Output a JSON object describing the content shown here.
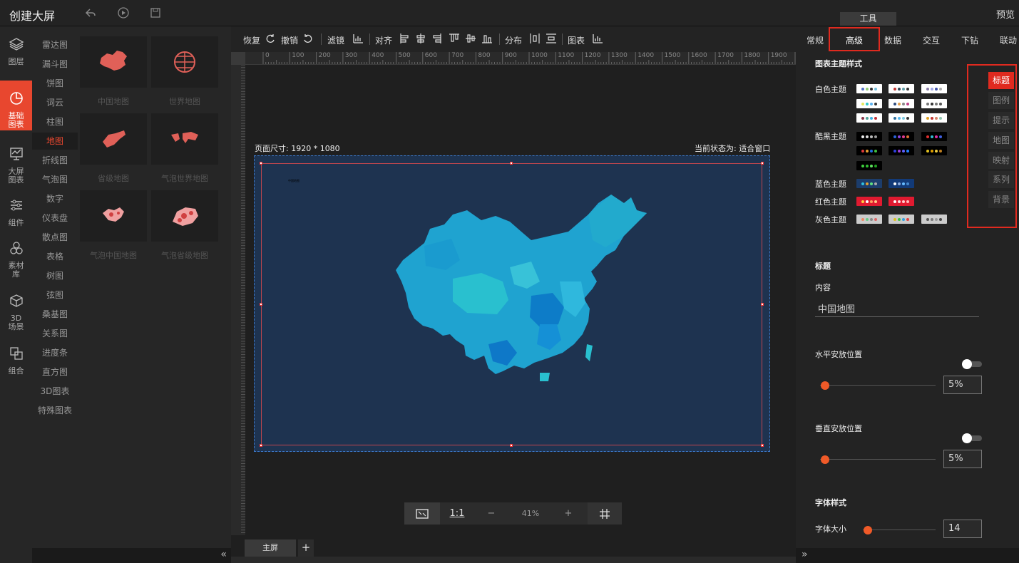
{
  "app": {
    "title": "创建大屏",
    "preview": "预览",
    "tool_tab": "工具"
  },
  "leftnav": [
    {
      "label": "图层",
      "icon": "layers-icon"
    },
    {
      "label": "基础图表",
      "icon": "pie-chart-icon",
      "active": true
    },
    {
      "label": "大屏图表",
      "icon": "dashboard-icon"
    },
    {
      "label": "组件",
      "icon": "sliders-icon"
    },
    {
      "label": "素材库",
      "icon": "hexagon-icon"
    },
    {
      "label": "3D场景",
      "icon": "cube-icon"
    },
    {
      "label": "组合",
      "icon": "combine-icon"
    }
  ],
  "categories": [
    "雷达图",
    "漏斗图",
    "饼图",
    "词云",
    "柱图",
    "地图",
    "折线图",
    "气泡图",
    "数字",
    "仪表盘",
    "散点图",
    "表格",
    "树图",
    "弦图",
    "桑基图",
    "关系图",
    "进度条",
    "直方图",
    "3D图表",
    "特殊图表"
  ],
  "active_category": "地图",
  "thumbs": [
    "中国地图",
    "世界地图",
    "省级地图",
    "气泡世界地图",
    "气泡中国地图",
    "气泡省级地图"
  ],
  "toolbar": {
    "redo": "恢复",
    "undo": "撤销",
    "filter": "滤镜",
    "align": "对齐",
    "distribute": "分布",
    "chart": "图表"
  },
  "ruler": [
    "0",
    "100",
    "200",
    "300",
    "400",
    "500",
    "600",
    "700",
    "800",
    "900",
    "1000",
    "1100",
    "1200",
    "1300",
    "1400",
    "1500",
    "1600",
    "1700",
    "1800",
    "1900"
  ],
  "canvas": {
    "page_size": "页面尺寸: 1920 * 1080",
    "status": "当前状态为: 适合窗口",
    "map_title": "中国地图"
  },
  "zoom": {
    "one_to_one": "1:1",
    "minus": "−",
    "level": "41%",
    "plus": "+"
  },
  "screens": {
    "main": "主屏",
    "add": "+"
  },
  "right": {
    "tabs": [
      "常规",
      "高级",
      "数据",
      "交互",
      "下钻",
      "联动"
    ],
    "active_tab": "高级",
    "theme_section": "图表主题样式",
    "themes": [
      {
        "label": "白色主题"
      },
      {
        "label": "酷黑主题"
      },
      {
        "label": "蓝色主题"
      },
      {
        "label": "红色主题"
      },
      {
        "label": "灰色主题"
      }
    ],
    "side_tabs": [
      "标题",
      "图例",
      "提示",
      "地图",
      "映射",
      "系列",
      "背景"
    ],
    "active_side_tab": "标题",
    "title_section": "标题",
    "content_label": "内容",
    "content_value": "中国地图",
    "h_pos_label": "水平安放位置",
    "h_pos_value": "5%",
    "v_pos_label": "垂直安放位置",
    "v_pos_value": "5%",
    "font_section": "字体样式",
    "font_size_label": "字体大小",
    "font_size_value": "14"
  },
  "colors": {
    "accent": "#e8472f",
    "highlight_box": "#e02a1f",
    "canvas_bg": "#1e3350",
    "map_fill": "#1fa3d0",
    "slider": "#f05a28"
  }
}
